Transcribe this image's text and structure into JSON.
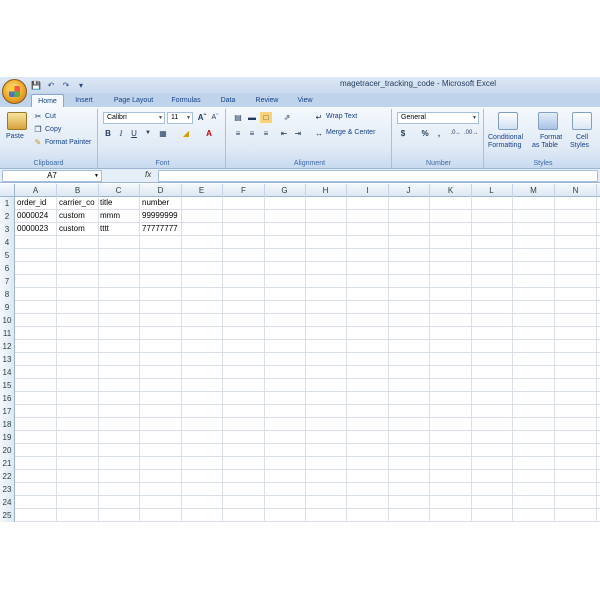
{
  "window": {
    "title": "magetracer_tracking_code - Microsoft Excel"
  },
  "qat": {
    "save_icon": "save-icon",
    "undo_icon": "undo-icon",
    "redo_icon": "redo-icon"
  },
  "tabs": [
    {
      "label": "Home",
      "active": true
    },
    {
      "label": "Insert"
    },
    {
      "label": "Page Layout"
    },
    {
      "label": "Formulas"
    },
    {
      "label": "Data"
    },
    {
      "label": "Review"
    },
    {
      "label": "View"
    }
  ],
  "ribbon": {
    "clipboard": {
      "paste": "Paste",
      "cut": "Cut",
      "copy": "Copy",
      "format_painter": "Format Painter",
      "label": "Clipboard"
    },
    "font": {
      "name": "Calibri",
      "size": "11",
      "label": "Font",
      "bold": "B",
      "italic": "I",
      "underline": "U"
    },
    "alignment": {
      "wrap_text": "Wrap Text",
      "merge_center": "Merge & Center",
      "label": "Alignment"
    },
    "number": {
      "format": "General",
      "currency": "$",
      "percent": "%",
      "comma": ",",
      "label": "Number"
    },
    "styles": {
      "conditional_1": "Conditional",
      "conditional_2": "Formatting",
      "format_table_1": "Format",
      "format_table_2": "as Table",
      "cell_styles_1": "Cell",
      "cell_styles_2": "Styles",
      "label": "Styles"
    }
  },
  "formula_bar": {
    "name_box": "A7",
    "fx": "fx",
    "content": ""
  },
  "columns": [
    "A",
    "B",
    "C",
    "D",
    "E",
    "F",
    "G",
    "H",
    "I",
    "J",
    "K",
    "L",
    "M",
    "N"
  ],
  "row_numbers": [
    "1",
    "2",
    "3",
    "4",
    "5",
    "6",
    "7",
    "8",
    "9",
    "10",
    "11",
    "12",
    "13",
    "14",
    "15",
    "16",
    "17",
    "18",
    "19",
    "20",
    "21",
    "22",
    "23",
    "24",
    "25"
  ],
  "cells": [
    [
      "order_id",
      "carrier_co",
      "title",
      "number"
    ],
    [
      "0000024",
      "custom",
      "mmm",
      "99999999"
    ],
    [
      "0000023",
      "custom",
      "tttt",
      "77777777"
    ]
  ]
}
